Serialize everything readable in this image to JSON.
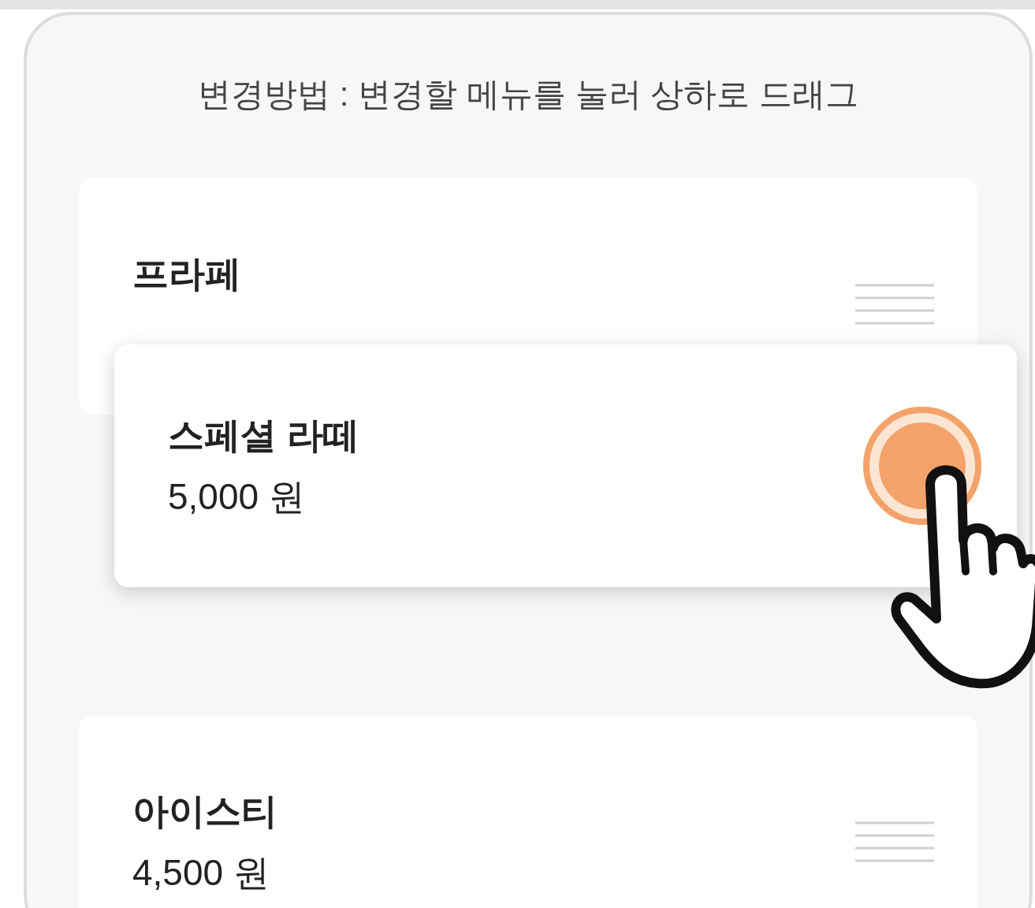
{
  "instruction": "변경방법 : 변경할 메뉴를 눌러 상하로 드래그",
  "menu_items": [
    {
      "name": "프라페",
      "dragging": false
    },
    {
      "name": "스페셜 라떼",
      "price": "5,000 원",
      "dragging": true
    },
    {
      "name": "아이스티",
      "price": "4,500 원",
      "dragging": false
    }
  ]
}
